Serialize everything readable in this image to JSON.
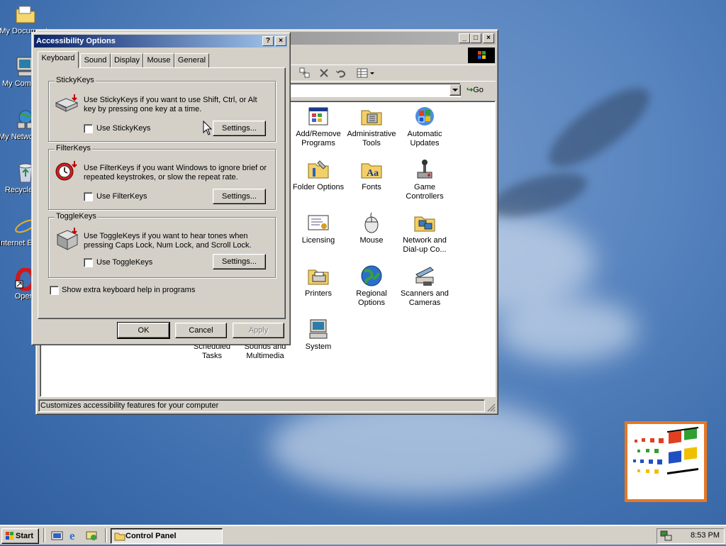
{
  "desktop": {
    "icons": [
      {
        "label": "My Documents",
        "icon": "folder-documents-icon"
      },
      {
        "label": "My Computer",
        "icon": "computer-icon"
      },
      {
        "label": "My Network Places",
        "icon": "network-places-icon"
      },
      {
        "label": "Recycle Bin",
        "icon": "recycle-bin-icon"
      },
      {
        "label": "Internet Explorer",
        "icon": "internet-explorer-icon"
      },
      {
        "label": "Opera",
        "icon": "opera-icon"
      }
    ]
  },
  "control_panel": {
    "go_label": "Go",
    "status_text": "Customizes accessibility features for your computer",
    "items": [
      {
        "label": "Add/Remove\nPrograms",
        "icon": "add-remove-programs-icon"
      },
      {
        "label": "Administrative\nTools",
        "icon": "administrative-tools-icon"
      },
      {
        "label": "Automatic\nUpdates",
        "icon": "windows-update-icon"
      },
      {
        "label": "Folder Options",
        "icon": "folder-options-icon"
      },
      {
        "label": "Fonts",
        "icon": "fonts-icon"
      },
      {
        "label": "Game\nControllers",
        "icon": "joystick-icon"
      },
      {
        "label": "Licensing",
        "icon": "certificate-icon"
      },
      {
        "label": "Mouse",
        "icon": "mouse-icon"
      },
      {
        "label": "Network and\nDial-up Co...",
        "icon": "network-dialup-icon"
      },
      {
        "label": "Printers",
        "icon": "printer-icon"
      },
      {
        "label": "Regional\nOptions",
        "icon": "globe-icon"
      },
      {
        "label": "Scanners and\nCameras",
        "icon": "scanner-icon"
      },
      {
        "label": "Scheduled\nTasks",
        "icon": "scheduled-tasks-icon"
      },
      {
        "label": "Sounds and\nMultimedia",
        "icon": "sounds-icon"
      },
      {
        "label": "System",
        "icon": "system-computer-icon"
      }
    ]
  },
  "dialog": {
    "title": "Accessibility Options",
    "tabs": [
      "Keyboard",
      "Sound",
      "Display",
      "Mouse",
      "General"
    ],
    "active_tab": "Keyboard",
    "groups": [
      {
        "legend": "StickyKeys",
        "description": "Use StickyKeys if you want to use Shift, Ctrl, or Alt key by pressing one key at a time.",
        "checkbox": "Use StickyKeys",
        "checked": false,
        "settings": "Settings..."
      },
      {
        "legend": "FilterKeys",
        "description": "Use FilterKeys if you want Windows to ignore brief or repeated keystrokes, or slow the repeat rate.",
        "checkbox": "Use FilterKeys",
        "checked": false,
        "settings": "Settings..."
      },
      {
        "legend": "ToggleKeys",
        "description": "Use ToggleKeys if you want to hear tones when pressing Caps Lock, Num Lock, and Scroll Lock.",
        "checkbox": "Use ToggleKeys",
        "checked": false,
        "settings": "Settings..."
      }
    ],
    "extra_help": "Show extra keyboard help in programs",
    "ok": "OK",
    "cancel": "Cancel",
    "apply": "Apply"
  },
  "taskbar": {
    "start": "Start",
    "task": "Control Panel",
    "clock": "8:53 PM"
  },
  "colors": {
    "desktop": "#3f6fae",
    "active_title_start": "#0a246a",
    "active_title_end": "#a6caf0",
    "face": "#d4d0c8"
  }
}
